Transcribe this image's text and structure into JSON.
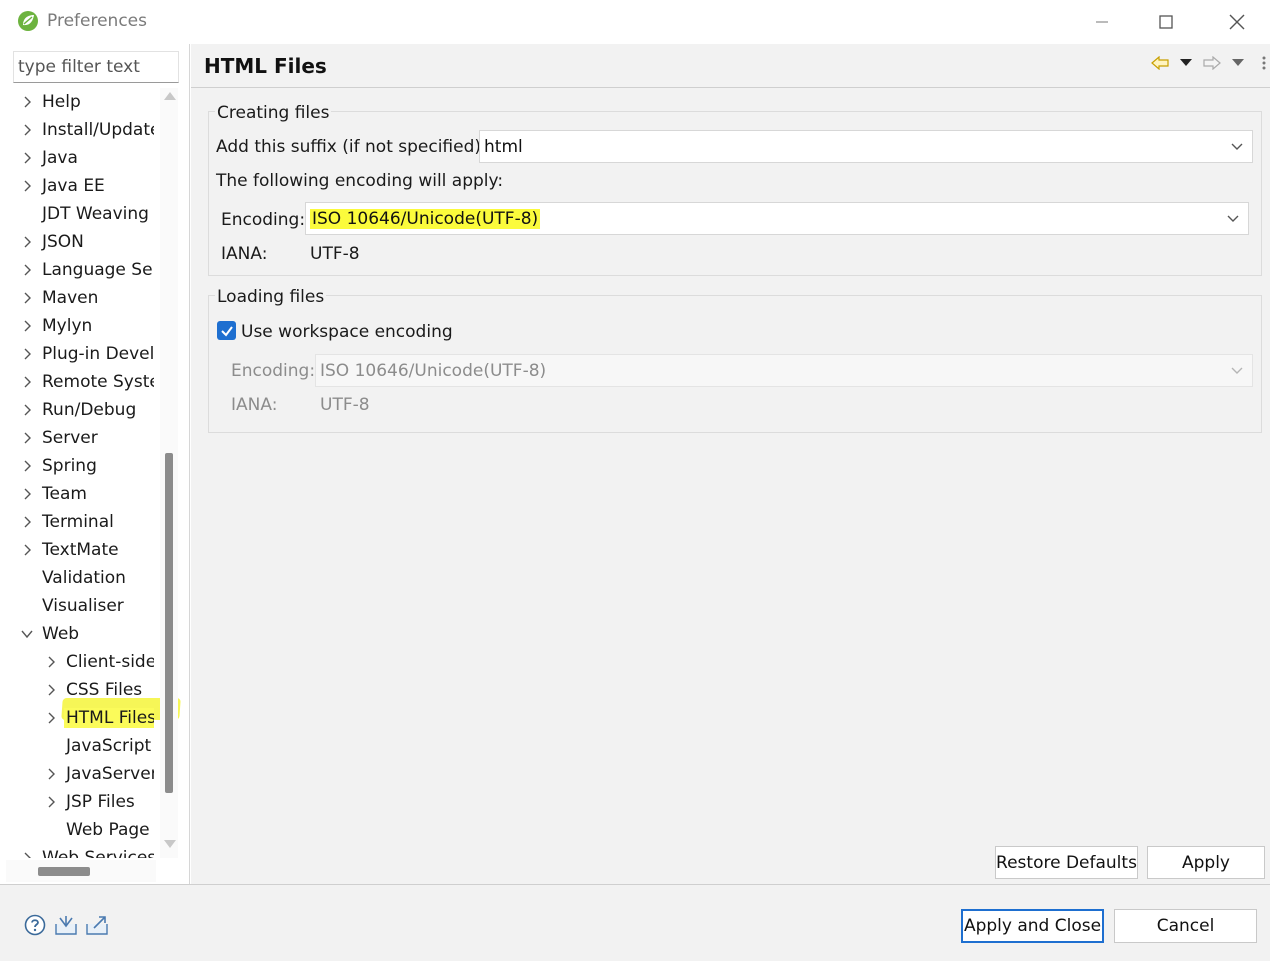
{
  "window": {
    "title": "Preferences",
    "logo_icon": "spring-leaf-icon",
    "controls": [
      "minimize-icon",
      "maximize-icon",
      "close-icon"
    ]
  },
  "sidebar": {
    "filter_placeholder": "type filter text",
    "items": [
      {
        "label": "Help",
        "expander": "collapsed",
        "level": 0
      },
      {
        "label": "Install/Update",
        "expander": "collapsed",
        "level": 0
      },
      {
        "label": "Java",
        "expander": "collapsed",
        "level": 0
      },
      {
        "label": "Java EE",
        "expander": "collapsed",
        "level": 0
      },
      {
        "label": "JDT Weaving",
        "expander": "none",
        "level": 0
      },
      {
        "label": "JSON",
        "expander": "collapsed",
        "level": 0
      },
      {
        "label": "Language Ser",
        "expander": "collapsed",
        "level": 0
      },
      {
        "label": "Maven",
        "expander": "collapsed",
        "level": 0
      },
      {
        "label": "Mylyn",
        "expander": "collapsed",
        "level": 0
      },
      {
        "label": "Plug-in Develo",
        "expander": "collapsed",
        "level": 0
      },
      {
        "label": "Remote Syste",
        "expander": "collapsed",
        "level": 0
      },
      {
        "label": "Run/Debug",
        "expander": "collapsed",
        "level": 0
      },
      {
        "label": "Server",
        "expander": "collapsed",
        "level": 0
      },
      {
        "label": "Spring",
        "expander": "collapsed",
        "level": 0
      },
      {
        "label": "Team",
        "expander": "collapsed",
        "level": 0
      },
      {
        "label": "Terminal",
        "expander": "collapsed",
        "level": 0
      },
      {
        "label": "TextMate",
        "expander": "collapsed",
        "level": 0
      },
      {
        "label": "Validation",
        "expander": "none",
        "level": 0
      },
      {
        "label": "Visualiser",
        "expander": "none",
        "level": 0
      },
      {
        "label": "Web",
        "expander": "expanded",
        "level": 0
      },
      {
        "label": "Client-side",
        "expander": "collapsed",
        "level": 1
      },
      {
        "label": "CSS Files",
        "expander": "collapsed",
        "level": 1
      },
      {
        "label": "HTML Files",
        "expander": "collapsed",
        "level": 1,
        "selected": true
      },
      {
        "label": "JavaScript",
        "expander": "none",
        "level": 1
      },
      {
        "label": "JavaServer",
        "expander": "collapsed",
        "level": 1
      },
      {
        "label": "JSP Files",
        "expander": "collapsed",
        "level": 1
      },
      {
        "label": "Web Page",
        "expander": "none",
        "level": 1
      },
      {
        "label": "Web Services",
        "expander": "collapsed",
        "level": 0
      }
    ]
  },
  "page": {
    "title": "HTML Files",
    "nav_icons": [
      "back-arrow-icon",
      "back-dropdown-icon",
      "forward-arrow-icon",
      "forward-dropdown-icon",
      "view-menu-icon"
    ],
    "creating": {
      "group_label": "Creating files",
      "suffix_label": "Add this suffix (if not specified):",
      "suffix_value": "html",
      "following_label": "The following encoding will apply:",
      "encoding_label": "Encoding:",
      "encoding_value": "ISO 10646/Unicode(UTF-8)",
      "iana_label": "IANA:",
      "iana_value": "UTF-8"
    },
    "loading": {
      "group_label": "Loading files",
      "checkbox_label": "Use workspace encoding",
      "checkbox_checked": true,
      "encoding_label": "Encoding:",
      "encoding_value": "ISO 10646/Unicode(UTF-8)",
      "iana_label": "IANA:",
      "iana_value": "UTF-8"
    },
    "restore_defaults_label": "Restore Defaults",
    "apply_label": "Apply"
  },
  "footer": {
    "icons": [
      "help-icon",
      "import-icon",
      "export-icon"
    ],
    "apply_close_label": "Apply and Close",
    "cancel_label": "Cancel"
  },
  "colors": {
    "highlight": "#fbfb3c",
    "accent": "#1e6fd0",
    "panel_bg": "#f2f2f2"
  }
}
